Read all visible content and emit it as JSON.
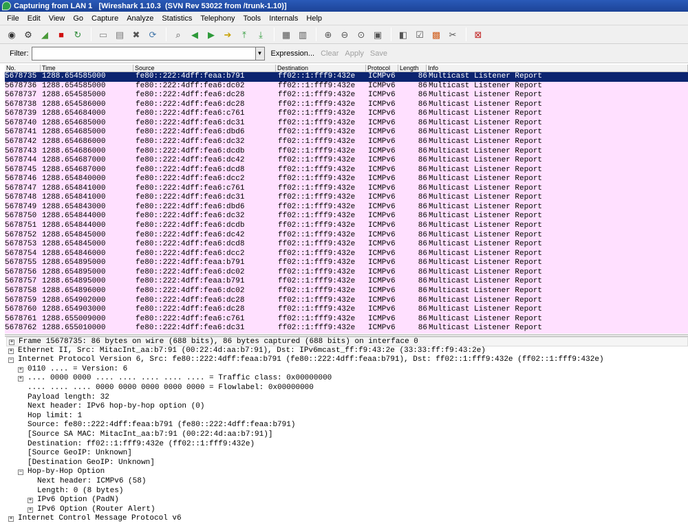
{
  "window": {
    "title": "Capturing from LAN 1   [Wireshark 1.10.3  (SVN Rev 53022 from /trunk-1.10)]"
  },
  "menu": [
    "File",
    "Edit",
    "View",
    "Go",
    "Capture",
    "Analyze",
    "Statistics",
    "Telephony",
    "Tools",
    "Internals",
    "Help"
  ],
  "toolbar": {
    "groups": [
      [
        {
          "name": "interfaces-icon",
          "glyph": "◉",
          "color": "#333333"
        },
        {
          "name": "capture-options-icon",
          "glyph": "⚙",
          "color": "#333333"
        },
        {
          "name": "start-capture-icon",
          "glyph": "◢",
          "color": "#4a9a3a"
        },
        {
          "name": "stop-capture-icon",
          "glyph": "■",
          "color": "#d01010"
        },
        {
          "name": "restart-capture-icon",
          "glyph": "↻",
          "color": "#2e8b3a"
        }
      ],
      [
        {
          "name": "open-file-icon",
          "glyph": "▭",
          "color": "#8a8a8a"
        },
        {
          "name": "save-file-icon",
          "glyph": "▤",
          "color": "#7a7a7a"
        },
        {
          "name": "close-file-icon",
          "glyph": "✖",
          "color": "#555555"
        },
        {
          "name": "reload-icon",
          "glyph": "⟳",
          "color": "#4477aa"
        }
      ],
      [
        {
          "name": "find-packet-icon",
          "glyph": "⌕",
          "color": "#555555"
        },
        {
          "name": "go-back-icon",
          "glyph": "◀",
          "color": "#2e9a3a"
        },
        {
          "name": "go-forward-icon",
          "glyph": "▶",
          "color": "#2e9a3a"
        },
        {
          "name": "go-to-packet-icon",
          "glyph": "➔",
          "color": "#c8a000"
        },
        {
          "name": "go-first-icon",
          "glyph": "⤒",
          "color": "#2e9a3a"
        },
        {
          "name": "go-last-icon",
          "glyph": "⤓",
          "color": "#2e9a3a"
        }
      ],
      [
        {
          "name": "colorize-icon",
          "glyph": "▦",
          "color": "#555555"
        },
        {
          "name": "auto-scroll-icon",
          "glyph": "▥",
          "color": "#555555"
        }
      ],
      [
        {
          "name": "zoom-in-icon",
          "glyph": "⊕",
          "color": "#555555"
        },
        {
          "name": "zoom-out-icon",
          "glyph": "⊖",
          "color": "#555555"
        },
        {
          "name": "normal-size-icon",
          "glyph": "⊙",
          "color": "#555555"
        },
        {
          "name": "resize-columns-icon",
          "glyph": "▣",
          "color": "#555555"
        }
      ],
      [
        {
          "name": "capture-filters-icon",
          "glyph": "◧",
          "color": "#555555"
        },
        {
          "name": "display-filters-icon",
          "glyph": "☑",
          "color": "#555555"
        },
        {
          "name": "coloring-rules-icon",
          "glyph": "▩",
          "color": "#d06020"
        },
        {
          "name": "preferences-icon",
          "glyph": "✂",
          "color": "#555555"
        }
      ],
      [
        {
          "name": "help-icon",
          "glyph": "⊠",
          "color": "#c02020"
        }
      ]
    ]
  },
  "filter": {
    "label": "Filter:",
    "value": "",
    "expression": "Expression...",
    "clear": "Clear",
    "apply": "Apply",
    "save": "Save"
  },
  "packet_list": {
    "columns": [
      "No.",
      "Time",
      "Source",
      "Destination",
      "Protocol",
      "Length",
      "Info"
    ],
    "rows": [
      {
        "no": "5678735",
        "time": "1288.654585000",
        "src": "fe80::222:4dff:feaa:b791",
        "dst": "ff02::1:fff9:432e",
        "proto": "ICMPv6",
        "len": "86",
        "info": "Multicast Listener Report"
      },
      {
        "no": "5678736",
        "time": "1288.654585000",
        "src": "fe80::222:4dff:fea6:dc02",
        "dst": "ff02::1:fff9:432e",
        "proto": "ICMPv6",
        "len": "86",
        "info": "Multicast Listener Report"
      },
      {
        "no": "5678737",
        "time": "1288.654585000",
        "src": "fe80::222:4dff:fea6:dc28",
        "dst": "ff02::1:fff9:432e",
        "proto": "ICMPv6",
        "len": "86",
        "info": "Multicast Listener Report"
      },
      {
        "no": "5678738",
        "time": "1288.654586000",
        "src": "fe80::222:4dff:fea6:dc28",
        "dst": "ff02::1:fff9:432e",
        "proto": "ICMPv6",
        "len": "86",
        "info": "Multicast Listener Report"
      },
      {
        "no": "5678739",
        "time": "1288.654684000",
        "src": "fe80::222:4dff:fea6:c761",
        "dst": "ff02::1:fff9:432e",
        "proto": "ICMPv6",
        "len": "86",
        "info": "Multicast Listener Report"
      },
      {
        "no": "5678740",
        "time": "1288.654685000",
        "src": "fe80::222:4dff:fea6:dc31",
        "dst": "ff02::1:fff9:432e",
        "proto": "ICMPv6",
        "len": "86",
        "info": "Multicast Listener Report"
      },
      {
        "no": "5678741",
        "time": "1288.654685000",
        "src": "fe80::222:4dff:fea6:dbd6",
        "dst": "ff02::1:fff9:432e",
        "proto": "ICMPv6",
        "len": "86",
        "info": "Multicast Listener Report"
      },
      {
        "no": "5678742",
        "time": "1288.654686000",
        "src": "fe80::222:4dff:fea6:dc32",
        "dst": "ff02::1:fff9:432e",
        "proto": "ICMPv6",
        "len": "86",
        "info": "Multicast Listener Report"
      },
      {
        "no": "5678743",
        "time": "1288.654686000",
        "src": "fe80::222:4dff:fea6:dcdb",
        "dst": "ff02::1:fff9:432e",
        "proto": "ICMPv6",
        "len": "86",
        "info": "Multicast Listener Report"
      },
      {
        "no": "5678744",
        "time": "1288.654687000",
        "src": "fe80::222:4dff:fea6:dc42",
        "dst": "ff02::1:fff9:432e",
        "proto": "ICMPv6",
        "len": "86",
        "info": "Multicast Listener Report"
      },
      {
        "no": "5678745",
        "time": "1288.654687000",
        "src": "fe80::222:4dff:fea6:dcd8",
        "dst": "ff02::1:fff9:432e",
        "proto": "ICMPv6",
        "len": "86",
        "info": "Multicast Listener Report"
      },
      {
        "no": "5678746",
        "time": "1288.654840000",
        "src": "fe80::222:4dff:fea6:dcc2",
        "dst": "ff02::1:fff9:432e",
        "proto": "ICMPv6",
        "len": "86",
        "info": "Multicast Listener Report"
      },
      {
        "no": "5678747",
        "time": "1288.654841000",
        "src": "fe80::222:4dff:fea6:c761",
        "dst": "ff02::1:fff9:432e",
        "proto": "ICMPv6",
        "len": "86",
        "info": "Multicast Listener Report"
      },
      {
        "no": "5678748",
        "time": "1288.654841000",
        "src": "fe80::222:4dff:fea6:dc31",
        "dst": "ff02::1:fff9:432e",
        "proto": "ICMPv6",
        "len": "86",
        "info": "Multicast Listener Report"
      },
      {
        "no": "5678749",
        "time": "1288.654843000",
        "src": "fe80::222:4dff:fea6:dbd6",
        "dst": "ff02::1:fff9:432e",
        "proto": "ICMPv6",
        "len": "86",
        "info": "Multicast Listener Report"
      },
      {
        "no": "5678750",
        "time": "1288.654844000",
        "src": "fe80::222:4dff:fea6:dc32",
        "dst": "ff02::1:fff9:432e",
        "proto": "ICMPv6",
        "len": "86",
        "info": "Multicast Listener Report"
      },
      {
        "no": "5678751",
        "time": "1288.654844000",
        "src": "fe80::222:4dff:fea6:dcdb",
        "dst": "ff02::1:fff9:432e",
        "proto": "ICMPv6",
        "len": "86",
        "info": "Multicast Listener Report"
      },
      {
        "no": "5678752",
        "time": "1288.654845000",
        "src": "fe80::222:4dff:fea6:dc42",
        "dst": "ff02::1:fff9:432e",
        "proto": "ICMPv6",
        "len": "86",
        "info": "Multicast Listener Report"
      },
      {
        "no": "5678753",
        "time": "1288.654845000",
        "src": "fe80::222:4dff:fea6:dcd8",
        "dst": "ff02::1:fff9:432e",
        "proto": "ICMPv6",
        "len": "86",
        "info": "Multicast Listener Report"
      },
      {
        "no": "5678754",
        "time": "1288.654846000",
        "src": "fe80::222:4dff:fea6:dcc2",
        "dst": "ff02::1:fff9:432e",
        "proto": "ICMPv6",
        "len": "86",
        "info": "Multicast Listener Report"
      },
      {
        "no": "5678755",
        "time": "1288.654895000",
        "src": "fe80::222:4dff:feaa:b791",
        "dst": "ff02::1:fff9:432e",
        "proto": "ICMPv6",
        "len": "86",
        "info": "Multicast Listener Report"
      },
      {
        "no": "5678756",
        "time": "1288.654895000",
        "src": "fe80::222:4dff:fea6:dc02",
        "dst": "ff02::1:fff9:432e",
        "proto": "ICMPv6",
        "len": "86",
        "info": "Multicast Listener Report"
      },
      {
        "no": "5678757",
        "time": "1288.654895000",
        "src": "fe80::222:4dff:feaa:b791",
        "dst": "ff02::1:fff9:432e",
        "proto": "ICMPv6",
        "len": "86",
        "info": "Multicast Listener Report"
      },
      {
        "no": "5678758",
        "time": "1288.654896000",
        "src": "fe80::222:4dff:fea6:dc02",
        "dst": "ff02::1:fff9:432e",
        "proto": "ICMPv6",
        "len": "86",
        "info": "Multicast Listener Report"
      },
      {
        "no": "5678759",
        "time": "1288.654902000",
        "src": "fe80::222:4dff:fea6:dc28",
        "dst": "ff02::1:fff9:432e",
        "proto": "ICMPv6",
        "len": "86",
        "info": "Multicast Listener Report"
      },
      {
        "no": "5678760",
        "time": "1288.654903000",
        "src": "fe80::222:4dff:fea6:dc28",
        "dst": "ff02::1:fff9:432e",
        "proto": "ICMPv6",
        "len": "86",
        "info": "Multicast Listener Report"
      },
      {
        "no": "5678761",
        "time": "1288.655009000",
        "src": "fe80::222:4dff:fea6:c761",
        "dst": "ff02::1:fff9:432e",
        "proto": "ICMPv6",
        "len": "86",
        "info": "Multicast Listener Report"
      },
      {
        "no": "5678762",
        "time": "1288.655010000",
        "src": "fe80::222:4dff:fea6:dc31",
        "dst": "ff02::1:fff9:432e",
        "proto": "ICMPv6",
        "len": "86",
        "info": "Multicast Listener Report"
      }
    ]
  },
  "details": [
    {
      "level": 0,
      "toggle": "+",
      "text": "Frame 15678735: 86 bytes on wire (688 bits), 86 bytes captured (688 bits) on interface 0",
      "boxed": true
    },
    {
      "level": 0,
      "toggle": "+",
      "text": "Ethernet II, Src: MitacInt_aa:b7:91 (00:22:4d:aa:b7:91), Dst: IPv6mcast_ff:f9:43:2e (33:33:ff:f9:43:2e)",
      "boxed": false
    },
    {
      "level": 0,
      "toggle": "-",
      "text": "Internet Protocol Version 6, Src: fe80::222:4dff:feaa:b791 (fe80::222:4dff:feaa:b791), Dst: ff02::1:fff9:432e (ff02::1:fff9:432e)",
      "boxed": false
    },
    {
      "level": 1,
      "toggle": "+",
      "text": "0110 .... = Version: 6",
      "boxed": false
    },
    {
      "level": 1,
      "toggle": "+",
      "text": ".... 0000 0000 .... .... .... .... .... = Traffic class: 0x00000000",
      "boxed": false
    },
    {
      "level": 1,
      "toggle": "",
      "text": ".... .... .... 0000 0000 0000 0000 0000 = Flowlabel: 0x00000000",
      "boxed": false
    },
    {
      "level": 1,
      "toggle": "",
      "text": "Payload length: 32",
      "boxed": false
    },
    {
      "level": 1,
      "toggle": "",
      "text": "Next header: IPv6 hop-by-hop option (0)",
      "boxed": false
    },
    {
      "level": 1,
      "toggle": "",
      "text": "Hop limit: 1",
      "boxed": false
    },
    {
      "level": 1,
      "toggle": "",
      "text": "Source: fe80::222:4dff:feaa:b791 (fe80::222:4dff:feaa:b791)",
      "boxed": false
    },
    {
      "level": 1,
      "toggle": "",
      "text": "[Source SA MAC: MitacInt_aa:b7:91 (00:22:4d:aa:b7:91)]",
      "boxed": false
    },
    {
      "level": 1,
      "toggle": "",
      "text": "Destination: ff02::1:fff9:432e (ff02::1:fff9:432e)",
      "boxed": false
    },
    {
      "level": 1,
      "toggle": "",
      "text": "[Source GeoIP: Unknown]",
      "boxed": false
    },
    {
      "level": 1,
      "toggle": "",
      "text": "[Destination GeoIP: Unknown]",
      "boxed": false
    },
    {
      "level": 1,
      "toggle": "-",
      "text": "Hop-by-Hop Option",
      "boxed": false
    },
    {
      "level": 2,
      "toggle": "",
      "text": "Next header: ICMPv6 (58)",
      "boxed": false
    },
    {
      "level": 2,
      "toggle": "",
      "text": "Length: 0 (8 bytes)",
      "boxed": false
    },
    {
      "level": 2,
      "toggle": "+",
      "text": "IPv6 Option (PadN)",
      "boxed": false
    },
    {
      "level": 2,
      "toggle": "+",
      "text": "IPv6 Option (Router Alert)",
      "boxed": false
    },
    {
      "level": 0,
      "toggle": "+",
      "text": "Internet Control Message Protocol v6",
      "boxed": false
    }
  ]
}
